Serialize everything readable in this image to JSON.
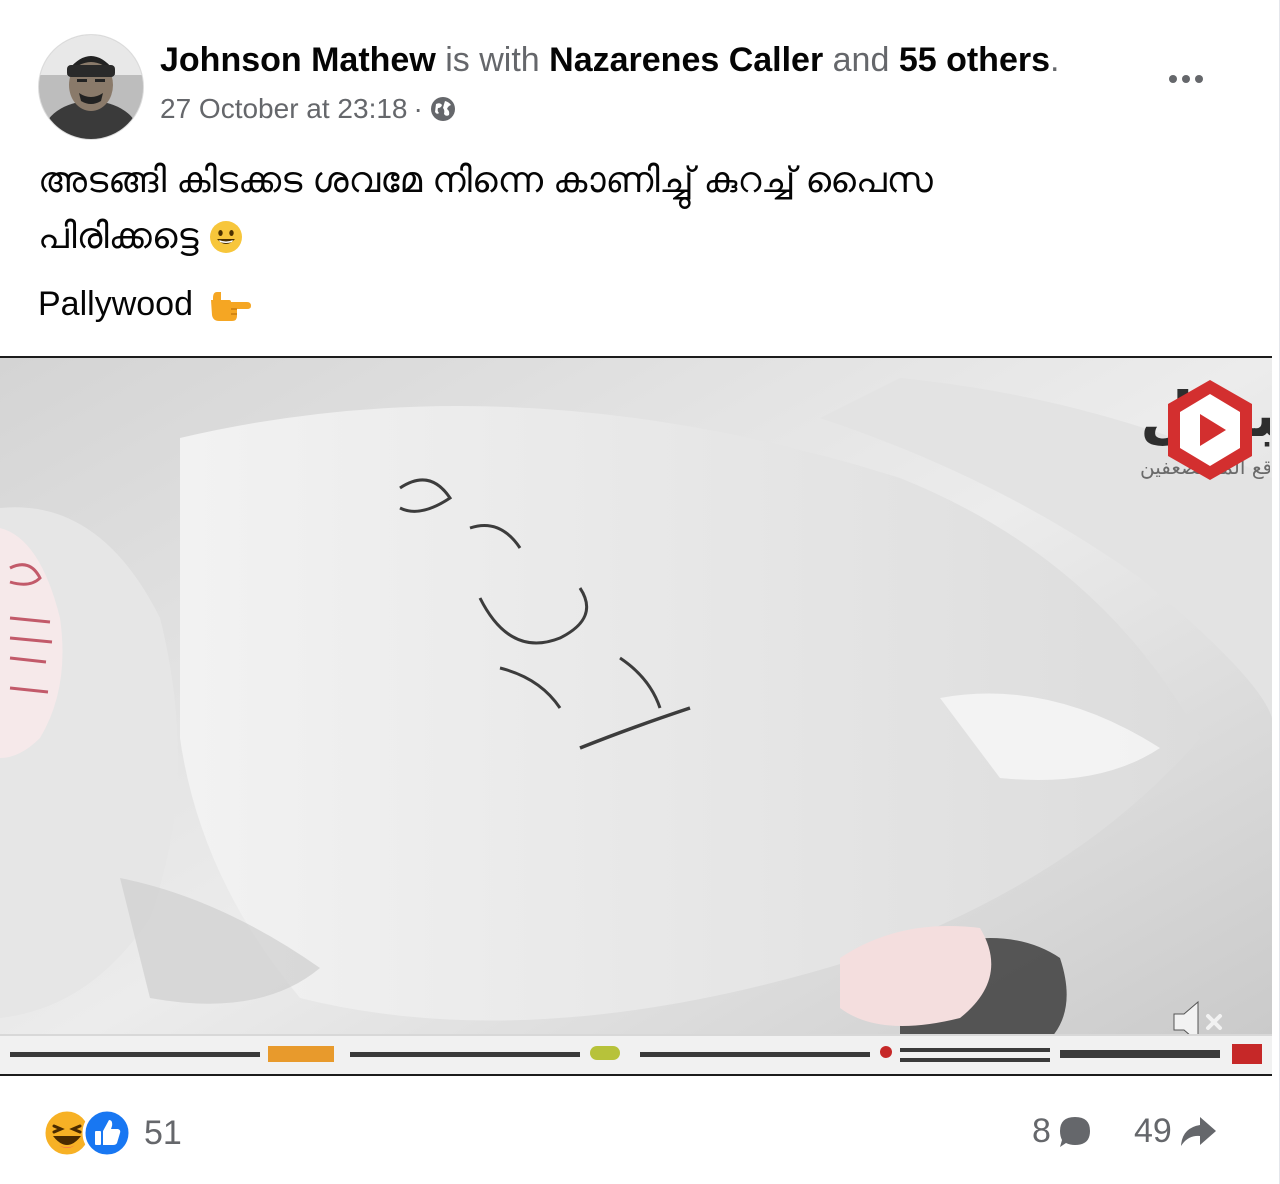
{
  "post": {
    "author": "Johnson Mathew",
    "with_text": " is with ",
    "tagged": "Nazarenes Caller",
    "and_text": " and ",
    "others": "55 others",
    "period": ".",
    "timestamp": "27 October at 23:18",
    "separator": "·",
    "audience_icon": "globe-icon",
    "more_icon": "more-options-icon",
    "text_line1": "അടങ്ങി കിടക്കട ശവമേ നിന്നെ കാണിച്ചു് കുറച്ച് പൈസ",
    "text_line2": "പിരിക്കട്ടെ",
    "text_emoji": "grinning-face-emoji",
    "tag_text": "Pallywood",
    "tag_emoji": "backhand-index-pointing-right-emoji"
  },
  "video": {
    "channel_logo": "البديل",
    "channel_tagline": "موقع المستضعفين",
    "handwriting": "أنس عبد",
    "mute_icon": "muted-speaker-icon"
  },
  "footer": {
    "reaction_icons": [
      "haha-reaction-icon",
      "like-reaction-icon"
    ],
    "reaction_count": "51",
    "comment_count": "8",
    "share_count": "49",
    "colors": {
      "like_blue": "#1877f2",
      "haha_yellow": "#f7b125",
      "muted_text": "#65676b"
    }
  }
}
